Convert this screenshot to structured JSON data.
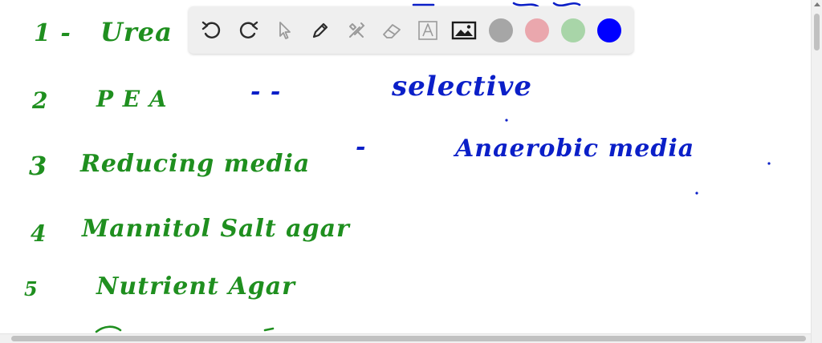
{
  "notes": {
    "lines": [
      {
        "id": "line-1",
        "number": "1 -",
        "text": "Urea",
        "color": "green"
      },
      {
        "id": "line-2",
        "number": "2",
        "text": "P E A",
        "color": "green"
      },
      {
        "id": "line-3",
        "number": "3",
        "text": "Reducing media",
        "color": "green"
      },
      {
        "id": "line-4",
        "number": "4",
        "text": "Mannitol  Salt agar",
        "color": "green"
      },
      {
        "id": "line-5",
        "number": "5",
        "text": "Nutrient  Agar",
        "color": "green"
      }
    ],
    "annotations": {
      "line2_dashes": "-        -",
      "selective": "selective",
      "line3_dash": "-",
      "anaerobic": "Anaerobic media"
    }
  },
  "toolbar": {
    "tools": [
      {
        "name": "undo-icon",
        "label": "Undo"
      },
      {
        "name": "redo-icon",
        "label": "Redo"
      },
      {
        "name": "select-pointer-icon",
        "label": "Select"
      },
      {
        "name": "pen-icon",
        "label": "Pen"
      },
      {
        "name": "tools-icon",
        "label": "Tools"
      },
      {
        "name": "eraser-icon",
        "label": "Eraser"
      },
      {
        "name": "text-icon",
        "label": "A"
      },
      {
        "name": "image-icon",
        "label": "Image"
      }
    ],
    "colors": [
      {
        "name": "gray",
        "hex": "#a6a6a6"
      },
      {
        "name": "pink",
        "hex": "#eaa7ad"
      },
      {
        "name": "light-green",
        "hex": "#a8d5a8"
      },
      {
        "name": "blue",
        "hex": "#0000ff"
      }
    ]
  },
  "colors": {
    "green_ink": "#1f8f1f",
    "blue_ink": "#0b1fc8",
    "toolbar_bg": "#efefef"
  }
}
